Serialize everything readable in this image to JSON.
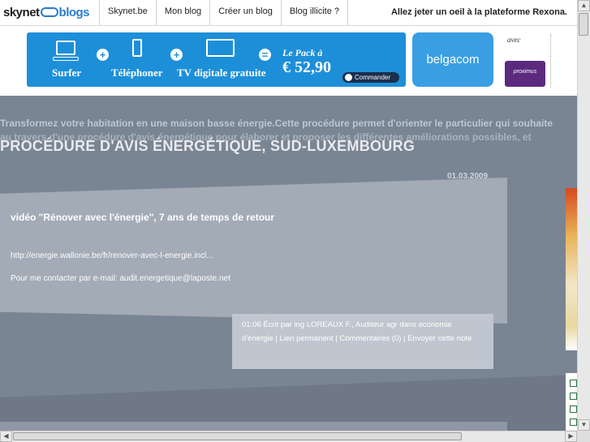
{
  "topbar": {
    "logo_a": "skynet",
    "logo_b": "blogs",
    "nav": [
      "Skynet.be",
      "Mon blog",
      "Créer un blog",
      "Blog illicite ?"
    ],
    "tagline": "Allez jeter un oeil à la plateforme Rexona."
  },
  "banner": {
    "surfer": "Surfer",
    "telephone": "Téléphoner",
    "tv": "TV digitale gratuite",
    "plus": "+",
    "equals": "=",
    "le_pack": "Le Pack à",
    "price": "€ 52,90",
    "commander": "Commander",
    "belgacom": "belgacom",
    "avec": "avec",
    "proximus": "proximus"
  },
  "main": {
    "marquee": "Transformez votre habitation en une maison basse énergie.Cette procédure permet d'orienter le particulier qui souhaite",
    "marquee2": "au travers d'une procédure d'avis énergétique pour élaborer et proposer les différentes améliorations possibles, et",
    "title": "PROCÉDURE D'AVIS ÉNERGÉTIQUE, SUD-LUXEMBOURG",
    "date": "01.03.2009"
  },
  "post": {
    "title": "vidéo \"Rénover avec l'énergie\", 7 ans de temps de retour",
    "link": "http://energie.wallonie.be/fr/renover-avec-l-energie.incl...",
    "contact_label": "Pour me contacter par e-mail: ",
    "email": "audit.energetique@laposte.net",
    "meta_time_author": "01:06 Écrit par ing LOREAUX F., Auditeur agr dans ",
    "category": "economie d'énergie",
    "permalink": "Lien permanent",
    "comments": "Commentaires (0)",
    "send": "Envoyer cette note",
    "sep": " | "
  }
}
